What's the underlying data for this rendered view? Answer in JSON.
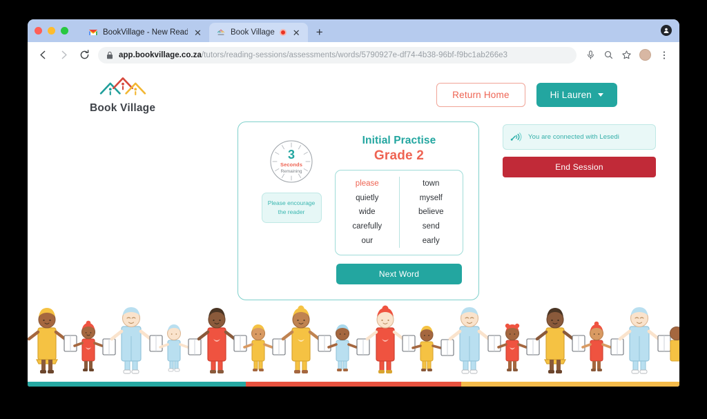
{
  "browser": {
    "tabs": [
      {
        "title": "BookVillage - New Reading Se",
        "favicon": "gmail-icon",
        "active": false
      },
      {
        "title": "Book Village",
        "favicon": "bookvillage-icon",
        "active": true,
        "recording": true
      }
    ],
    "new_tab_label": "+",
    "close_label": "✕",
    "url": {
      "host": "app.bookvillage.co.za",
      "path": "/tutors/reading-sessions/assessments/words/5790927e-df74-4b38-96bf-f9bc1ab266e3",
      "full": "app.bookvillage.co.za/tutors/reading-sessions/assessments/words/5790927e-df74-4b38-96bf-f9bc1ab266e3",
      "lock_icon": "lock-icon"
    },
    "toolbar_icons": [
      "back-icon",
      "forward-icon",
      "reload-icon",
      "microphone-icon",
      "search-icon",
      "bookmark-star-icon",
      "profile-avatar",
      "three-dot-menu-icon"
    ]
  },
  "header": {
    "brand_name": "Book Village",
    "return_home_label": "Return Home",
    "account_label": "Hi Lauren",
    "account_caret": "chevron-down-icon"
  },
  "practice": {
    "title": "Initial Practise",
    "grade": "Grade 2",
    "timer": {
      "value": "3",
      "unit": "Seconds",
      "caption": "Remaining"
    },
    "encourage_line1": "Please encourage",
    "encourage_line2": "the reader",
    "word_columns": [
      [
        "please",
        "quietly",
        "wide",
        "carefully",
        "our"
      ],
      [
        "town",
        "myself",
        "believe",
        "send",
        "early"
      ]
    ],
    "active_word": "please",
    "next_word_label": "Next Word"
  },
  "session": {
    "connected_text": "You are connected with Lesedi",
    "connected_icon": "connection-signal-icon",
    "end_session_label": "End Session"
  },
  "colors": {
    "teal": "#23a6a0",
    "salmon": "#ee6352",
    "yellow": "#f2b632",
    "crimson": "#c12a38",
    "light_teal_bg": "#e6f7f6",
    "card_border": "#7fd0cb"
  },
  "color_bar": [
    {
      "name": "teal-segment",
      "color": "#26a8a2",
      "width": "33.5%"
    },
    {
      "name": "salmon-segment",
      "color": "#e8523f",
      "width": "33%"
    },
    {
      "name": "yellow-segment",
      "color": "#f5bb4a",
      "width": "33.5%"
    }
  ]
}
